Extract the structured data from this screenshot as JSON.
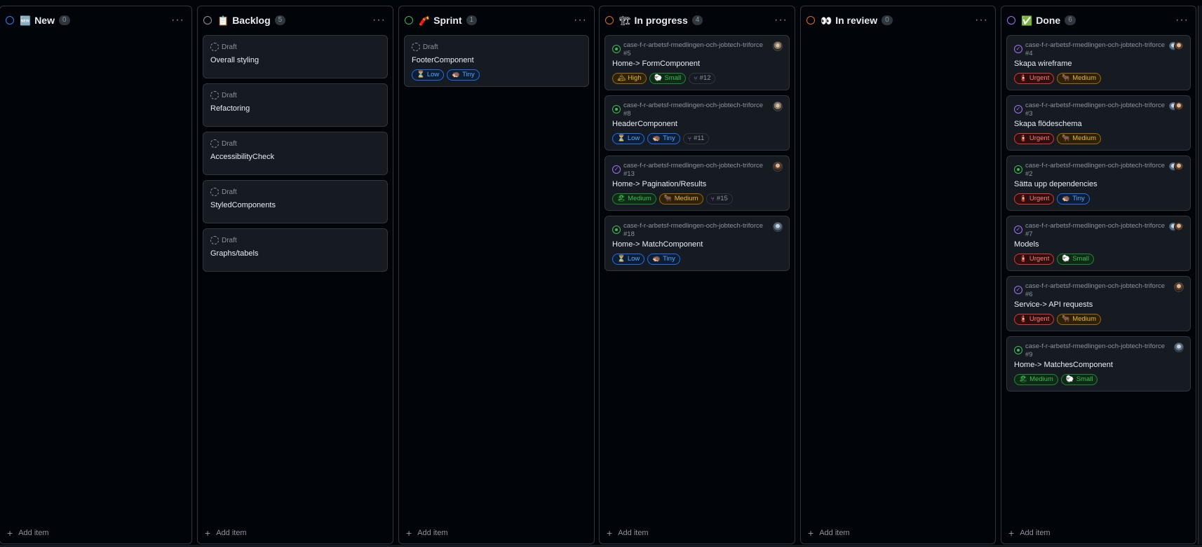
{
  "columns": [
    {
      "key": "new",
      "title": "New",
      "emoji": "🆕",
      "count": "0",
      "ring_color": "#2f81f7",
      "add_item": "Add item",
      "cards": []
    },
    {
      "key": "backlog",
      "title": "Backlog",
      "emoji": "📋",
      "count": "5",
      "ring_color": "#8b949e",
      "add_item": "Add item",
      "cards": [
        {
          "type": "draft",
          "status": "Draft",
          "title": "Overall styling"
        },
        {
          "type": "draft",
          "status": "Draft",
          "title": "Refactoring"
        },
        {
          "type": "draft",
          "status": "Draft",
          "title": "AccessibilityCheck"
        },
        {
          "type": "draft",
          "status": "Draft",
          "title": "StyledComponents"
        },
        {
          "type": "draft",
          "status": "Draft",
          "title": "Graphs/tabels"
        }
      ]
    },
    {
      "key": "sprint",
      "title": "Sprint",
      "emoji": "🧨",
      "count": "1",
      "ring_color": "#3fb950",
      "add_item": "Add item",
      "cards": [
        {
          "type": "draft",
          "status": "Draft",
          "title": "FooterComponent",
          "labels": [
            {
              "kind": "low",
              "icon": "⏳",
              "text": "Low"
            },
            {
              "kind": "tiny",
              "icon": "🦔",
              "text": "Tiny"
            }
          ]
        }
      ]
    },
    {
      "key": "in-progress",
      "title": "In progress",
      "emoji": "🏗",
      "count": "4",
      "ring_color": "#db6d28",
      "add_item": "Add item",
      "cards": [
        {
          "type": "issue",
          "state": "open",
          "repo": "case-f-r-arbetsf-rmedlingen-och-jobtech-triforce #5",
          "title": "Home-> FormComponent",
          "avatar": "a2",
          "labels": [
            {
              "kind": "high",
              "icon": "🏔",
              "text": "High"
            },
            {
              "kind": "small",
              "icon": "🐑",
              "text": "Small"
            },
            {
              "kind": "pr",
              "icon": "⑂",
              "text": "#12"
            }
          ]
        },
        {
          "type": "issue",
          "state": "open",
          "repo": "case-f-r-arbetsf-rmedlingen-och-jobtech-triforce #8",
          "title": "HeaderComponent",
          "avatar": "a2",
          "labels": [
            {
              "kind": "low",
              "icon": "⏳",
              "text": "Low"
            },
            {
              "kind": "tiny",
              "icon": "🦔",
              "text": "Tiny"
            },
            {
              "kind": "pr",
              "icon": "⑂",
              "text": "#11"
            }
          ]
        },
        {
          "type": "issue",
          "state": "closed",
          "repo": "case-f-r-arbetsf-rmedlingen-och-jobtech-triforce #13",
          "title": "Home-> Pagination/Results",
          "avatar": "a1",
          "labels": [
            {
              "kind": "medium-p",
              "icon": "🏖",
              "text": "Medium"
            },
            {
              "kind": "medium-s",
              "icon": "🐂",
              "text": "Medium"
            },
            {
              "kind": "pr",
              "icon": "⑂",
              "text": "#15"
            }
          ]
        },
        {
          "type": "issue",
          "state": "open",
          "repo": "case-f-r-arbetsf-rmedlingen-och-jobtech-triforce #18",
          "title": "Home-> MatchComponent",
          "avatar": "a3",
          "labels": [
            {
              "kind": "low",
              "icon": "⏳",
              "text": "Low"
            },
            {
              "kind": "tiny",
              "icon": "🦔",
              "text": "Tiny"
            }
          ]
        }
      ]
    },
    {
      "key": "in-review",
      "title": "In review",
      "emoji": "👀",
      "count": "0",
      "ring_color": "#db6d28",
      "add_item": "Add item",
      "cards": []
    },
    {
      "key": "done",
      "title": "Done",
      "emoji": "✅",
      "count": "6",
      "ring_color": "#a371f7",
      "add_item": "Add item",
      "cards": [
        {
          "type": "issue",
          "state": "closed",
          "repo": "case-f-r-arbetsf-rmedlingen-och-jobtech-triforce #4",
          "title": "Skapa wireframe",
          "avatar": "pair",
          "labels": [
            {
              "kind": "urgent",
              "icon": "🧯",
              "text": "Urgent"
            },
            {
              "kind": "medium-s",
              "icon": "🐂",
              "text": "Medium"
            }
          ]
        },
        {
          "type": "issue",
          "state": "closed",
          "repo": "case-f-r-arbetsf-rmedlingen-och-jobtech-triforce #3",
          "title": "Skapa flödeschema",
          "avatar": "pair",
          "labels": [
            {
              "kind": "urgent",
              "icon": "🧯",
              "text": "Urgent"
            },
            {
              "kind": "medium-s",
              "icon": "🐂",
              "text": "Medium"
            }
          ]
        },
        {
          "type": "issue",
          "state": "open",
          "repo": "case-f-r-arbetsf-rmedlingen-och-jobtech-triforce #2",
          "title": "Sätta upp dependencies",
          "avatar": "pair",
          "labels": [
            {
              "kind": "urgent",
              "icon": "🧯",
              "text": "Urgent"
            },
            {
              "kind": "tiny",
              "icon": "🦔",
              "text": "Tiny"
            }
          ]
        },
        {
          "type": "issue",
          "state": "closed",
          "repo": "case-f-r-arbetsf-rmedlingen-och-jobtech-triforce #7",
          "title": "Models",
          "avatar": "pair",
          "labels": [
            {
              "kind": "urgent",
              "icon": "🧯",
              "text": "Urgent"
            },
            {
              "kind": "small",
              "icon": "🐑",
              "text": "Small"
            }
          ]
        },
        {
          "type": "issue",
          "state": "closed",
          "repo": "case-f-r-arbetsf-rmedlingen-och-jobtech-triforce #6",
          "title": "Service-> API requests",
          "avatar": "a1",
          "labels": [
            {
              "kind": "urgent",
              "icon": "🧯",
              "text": "Urgent"
            },
            {
              "kind": "medium-s",
              "icon": "🐂",
              "text": "Medium"
            }
          ]
        },
        {
          "type": "issue",
          "state": "open",
          "repo": "case-f-r-arbetsf-rmedlingen-och-jobtech-triforce #9",
          "title": "Home-> MatchesComponent",
          "avatar": "a3",
          "labels": [
            {
              "kind": "medium-p",
              "icon": "🏖",
              "text": "Medium"
            },
            {
              "kind": "small",
              "icon": "🐑",
              "text": "Small"
            }
          ]
        }
      ]
    }
  ]
}
